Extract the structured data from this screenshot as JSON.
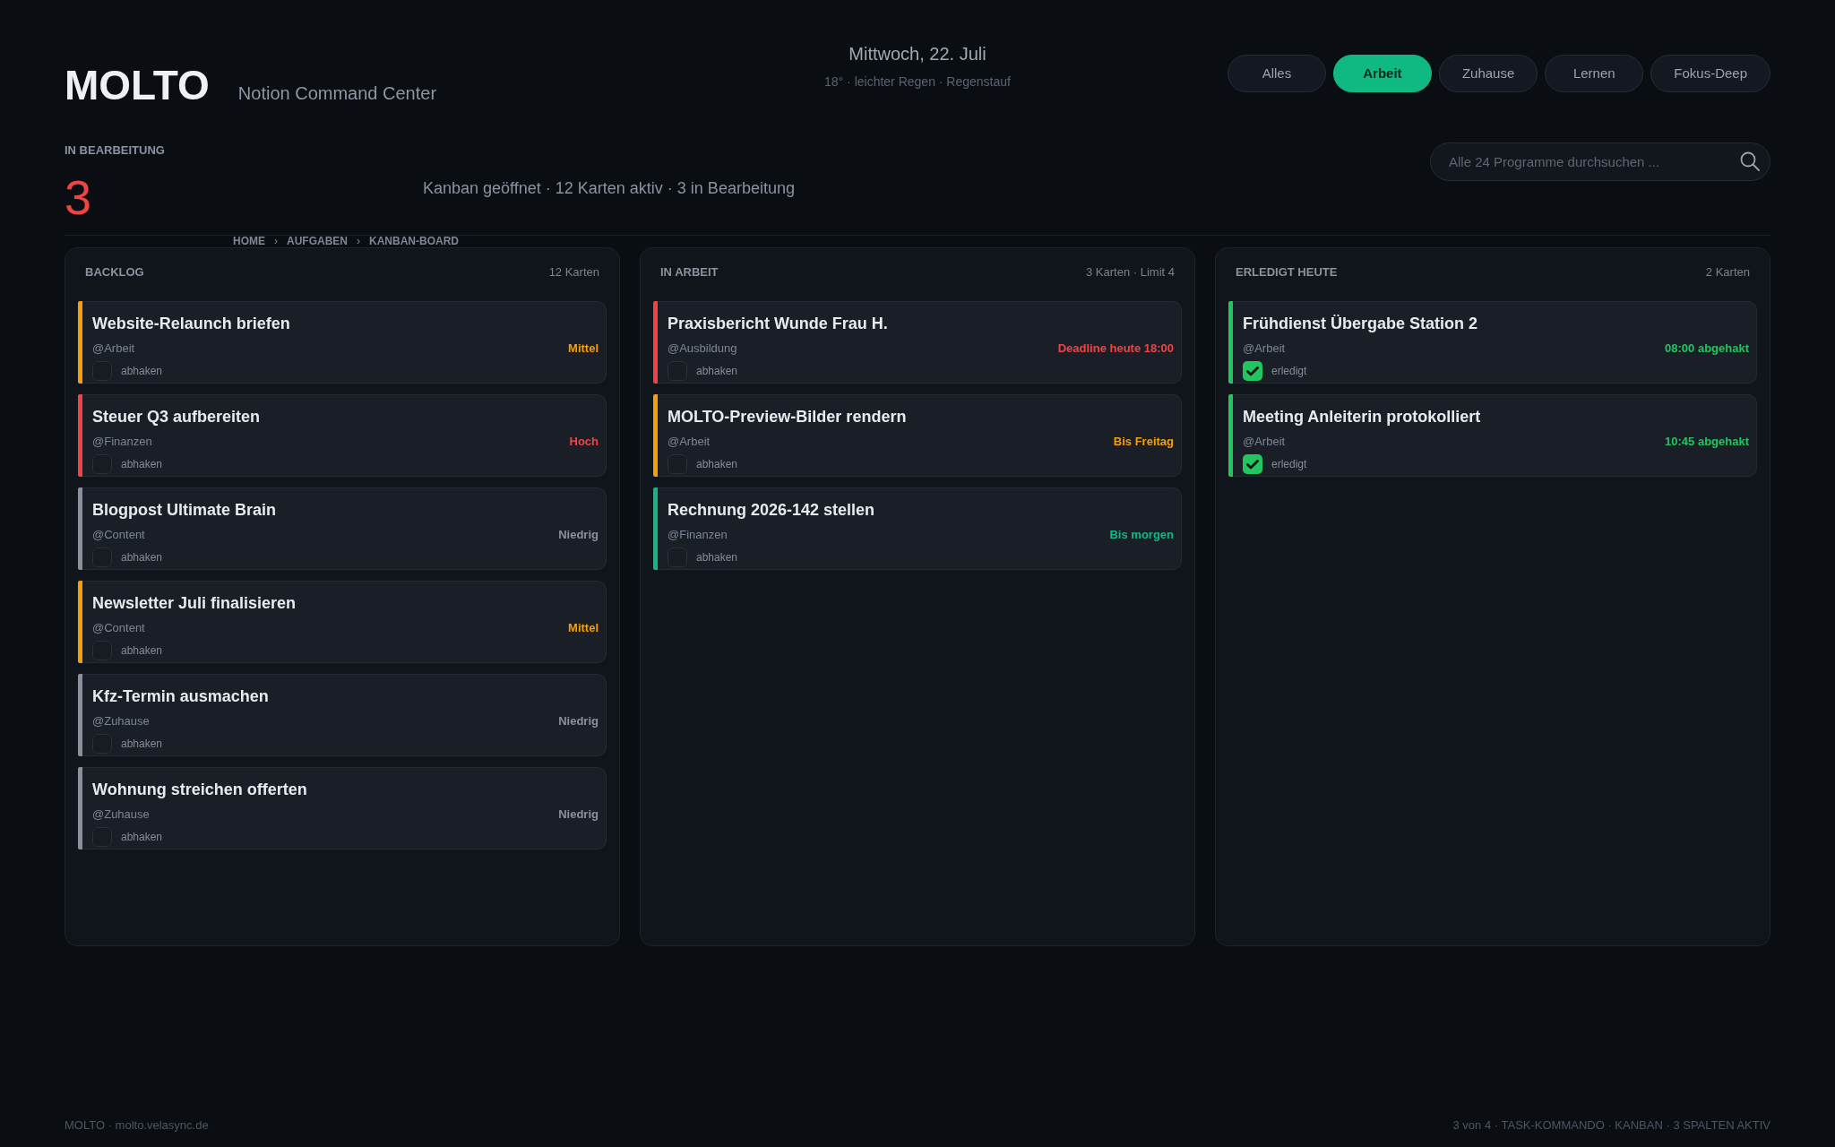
{
  "header": {
    "logo": "MOLTO",
    "subtitle": "Notion Command Center",
    "date": "Mittwoch, 22. Juli",
    "weather": "18° · leichter Regen · Regenstauf",
    "filters": [
      {
        "label": "Alles",
        "selected": false
      },
      {
        "label": "Arbeit",
        "selected": true
      },
      {
        "label": "Zuhause",
        "selected": false
      },
      {
        "label": "Lernen",
        "selected": false
      },
      {
        "label": "Fokus-Deep",
        "selected": false
      }
    ]
  },
  "stat": {
    "label": "IN BEARBEITUNG",
    "value": "3"
  },
  "summary": "Kanban geöffnet · 12 Karten aktiv · 3 in Bearbeitung",
  "search": {
    "placeholder": "Alle 24 Programme durchsuchen ..."
  },
  "breadcrumb": [
    {
      "kind": "link",
      "text": "HOME"
    },
    {
      "kind": "separator",
      "text": "›"
    },
    {
      "kind": "link",
      "text": "AUFGABEN"
    },
    {
      "kind": "separator",
      "text": "›"
    },
    {
      "kind": "link",
      "text": "KANBAN-BOARD"
    }
  ],
  "columns": [
    {
      "title": "BACKLOG",
      "count": "12 Karten",
      "cards": [
        {
          "title": "Website-Relaunch briefen",
          "tag": "@Arbeit",
          "status": "Mittel",
          "color": "#f59e0b",
          "checked": false,
          "check_label": "abhaken"
        },
        {
          "title": "Steuer Q3 aufbereiten",
          "tag": "@Finanzen",
          "status": "Hoch",
          "color": "#ef4444",
          "checked": false,
          "check_label": "abhaken"
        },
        {
          "title": "Blogpost Ultimate Brain",
          "tag": "@Content",
          "status": "Niedrig",
          "color": "#8a909c",
          "checked": false,
          "check_label": "abhaken"
        },
        {
          "title": "Newsletter Juli finalisieren",
          "tag": "@Content",
          "status": "Mittel",
          "color": "#f59e0b",
          "checked": false,
          "check_label": "abhaken"
        },
        {
          "title": "Kfz-Termin ausmachen",
          "tag": "@Zuhause",
          "status": "Niedrig",
          "color": "#8a909c",
          "checked": false,
          "check_label": "abhaken"
        },
        {
          "title": "Wohnung streichen offerten",
          "tag": "@Zuhause",
          "status": "Niedrig",
          "color": "#8a909c",
          "checked": false,
          "check_label": "abhaken"
        }
      ]
    },
    {
      "title": "IN ARBEIT",
      "count": "3 Karten · Limit 4",
      "cards": [
        {
          "title": "Praxisbericht Wunde Frau H.",
          "tag": "@Ausbildung",
          "status": "Deadline heute 18:00",
          "color": "#ef4444",
          "checked": false,
          "check_label": "abhaken"
        },
        {
          "title": "MOLTO-Preview-Bilder rendern",
          "tag": "@Arbeit",
          "status": "Bis Freitag",
          "color": "#f59e0b",
          "checked": false,
          "check_label": "abhaken"
        },
        {
          "title": "Rechnung 2026-142 stellen",
          "tag": "@Finanzen",
          "status": "Bis morgen",
          "color": "#10b981",
          "checked": false,
          "check_label": "abhaken"
        }
      ]
    },
    {
      "title": "ERLEDIGT HEUTE",
      "count": "2 Karten",
      "cards": [
        {
          "title": "Frühdienst Übergabe Station 2",
          "tag": "@Arbeit",
          "status": "08:00 abgehakt",
          "color": "#22c55e",
          "checked": true,
          "check_label": "erledigt"
        },
        {
          "title": "Meeting Anleiterin protokolliert",
          "tag": "@Arbeit",
          "status": "10:45 abgehakt",
          "color": "#22c55e",
          "checked": true,
          "check_label": "erledigt"
        }
      ]
    }
  ],
  "footer": {
    "left": "MOLTO · molto.velasync.de",
    "right": "3 von 4 · TASK-KOMMANDO · KANBAN · 3 SPALTEN AKTIV"
  }
}
